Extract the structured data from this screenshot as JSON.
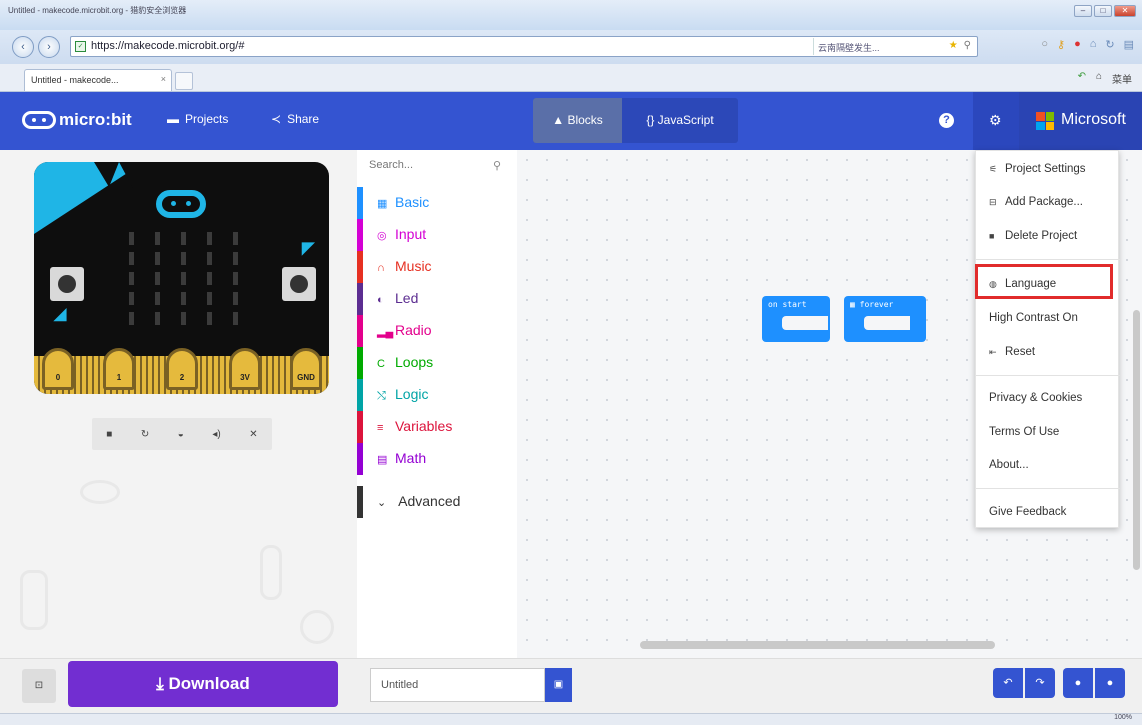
{
  "browser": {
    "title": "Untitled - makecode.microbit.org - 猎豹安全浏览器",
    "url": "https://makecode.microbit.org/#",
    "search_hint": "云南隔壁发生...",
    "tab_label": "Untitled - makecode...",
    "tab_close": "×",
    "menu_label": "菜单",
    "zoom": "100%"
  },
  "header": {
    "brand": "micro:bit",
    "projects": "Projects",
    "share": "Share",
    "blocks": "Blocks",
    "javascript": "{} JavaScript",
    "help": "?",
    "microsoft": "Microsoft"
  },
  "simulator": {
    "pins": [
      "0",
      "1",
      "2",
      "3V",
      "GND"
    ]
  },
  "toolbox": {
    "search_placeholder": "Search...",
    "categories": [
      {
        "label": "Basic",
        "color": "#1e90ff",
        "icon": "grid-icon"
      },
      {
        "label": "Input",
        "color": "#d400d4",
        "icon": "target-icon"
      },
      {
        "label": "Music",
        "color": "#e63022",
        "icon": "headphones-icon"
      },
      {
        "label": "Led",
        "color": "#5c2d91",
        "icon": "toggle-icon"
      },
      {
        "label": "Radio",
        "color": "#e3008c",
        "icon": "signal-icon"
      },
      {
        "label": "Loops",
        "color": "#00aa00",
        "icon": "loop-icon"
      },
      {
        "label": "Logic",
        "color": "#00a4a6",
        "icon": "shuffle-icon"
      },
      {
        "label": "Variables",
        "color": "#dc143c",
        "icon": "list-icon"
      },
      {
        "label": "Math",
        "color": "#9400d3",
        "icon": "calculator-icon"
      }
    ],
    "advanced": "Advanced"
  },
  "workspace": {
    "blocks": [
      "on start",
      "forever"
    ]
  },
  "menu": {
    "items": [
      "Project Settings",
      "Add Package...",
      "Delete Project",
      "Language",
      "High Contrast On",
      "Reset",
      "Privacy & Cookies",
      "Terms Of Use",
      "About...",
      "Give Feedback"
    ]
  },
  "footer": {
    "download": "Download",
    "filename": "Untitled"
  }
}
